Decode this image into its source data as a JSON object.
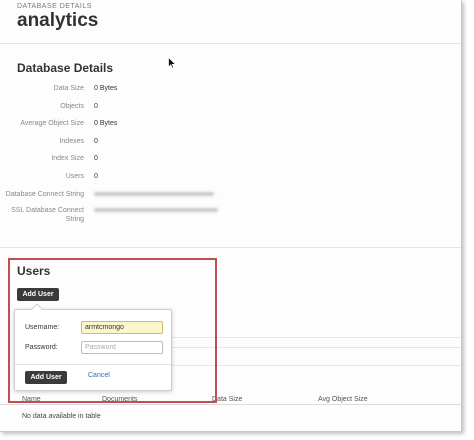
{
  "header": {
    "breadcrumb": "DATABASE DETAILS",
    "title": "analytics"
  },
  "details": {
    "heading": "Database Details",
    "rows": [
      {
        "label": "Data Size",
        "value": "0 Bytes"
      },
      {
        "label": "Objects",
        "value": "0"
      },
      {
        "label": "Average Object Size",
        "value": "0 Bytes"
      },
      {
        "label": "Indexes",
        "value": "0"
      },
      {
        "label": "Index Size",
        "value": "0"
      },
      {
        "label": "Users",
        "value": "0"
      }
    ],
    "connect_label": "Database Connect String",
    "ssl_label": "SSL Database Connect String"
  },
  "users": {
    "heading": "Users",
    "add_user_label": "Add User"
  },
  "popover": {
    "username_label": "Username:",
    "username_value": "armtcmongo",
    "password_label": "Password:",
    "password_placeholder": "Password",
    "submit_label": "Add User",
    "cancel_label": "Cancel"
  },
  "collections": {
    "columns": [
      "Name",
      "Documents",
      "Data Size",
      "Avg Object Size"
    ],
    "empty_text": "No data available in table"
  },
  "colors": {
    "callout": "#c0504d",
    "button": "#3a3a3a",
    "link": "#2a6ebb",
    "input_highlight": "#fbf6cc"
  }
}
